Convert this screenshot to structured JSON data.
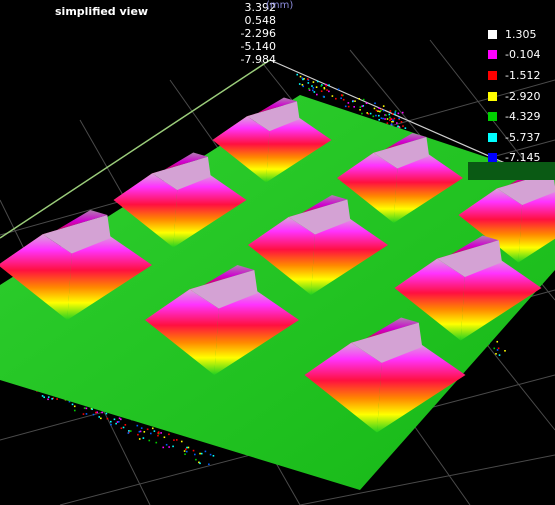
{
  "view": {
    "title": "simplified view"
  },
  "axis": {
    "unit": "(mm)",
    "ticks": [
      "3.392",
      "0.548",
      "-2.296",
      "-5.140",
      "-7.984"
    ]
  },
  "legend": {
    "items": [
      {
        "label": "1.305",
        "color": "#ffffff"
      },
      {
        "label": "-0.104",
        "color": "#ff00ff"
      },
      {
        "label": "-1.512",
        "color": "#ff0000"
      },
      {
        "label": "-2.920",
        "color": "#ffff00"
      },
      {
        "label": "-4.329",
        "color": "#00d000"
      },
      {
        "label": "-5.737",
        "color": "#00ffff"
      },
      {
        "label": "-7.145",
        "color": "#0000ff"
      }
    ]
  },
  "scene": {
    "background": "#000000",
    "grid_color": "#4a4a4a",
    "plate_color": "#22c622",
    "pyramid_count": 9
  }
}
